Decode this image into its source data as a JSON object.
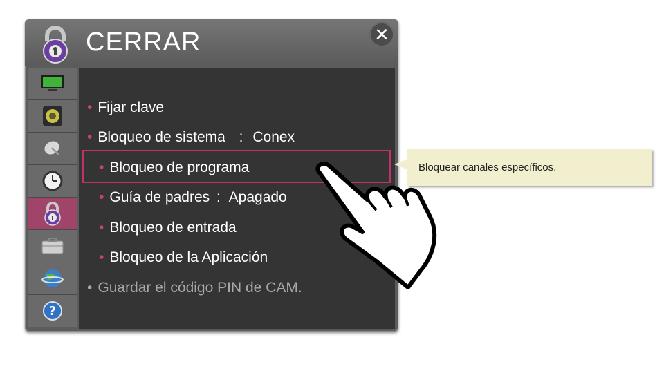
{
  "header": {
    "title": "CERRAR",
    "close_label": "✕"
  },
  "sidebar": {
    "items": [
      {
        "icon": "tv-icon"
      },
      {
        "icon": "speaker-icon"
      },
      {
        "icon": "satellite-icon"
      },
      {
        "icon": "clock-icon"
      },
      {
        "icon": "lock-icon",
        "active": true
      },
      {
        "icon": "toolbox-icon"
      },
      {
        "icon": "network-globe-icon"
      },
      {
        "icon": "help-icon"
      }
    ]
  },
  "menu": {
    "fijar_clave": "Fijar clave",
    "bloqueo_sistema": "Bloqueo de sistema",
    "bloqueo_sistema_sep": ":",
    "bloqueo_sistema_value": "Conex",
    "bloqueo_programa": "Bloqueo de programa",
    "guia_padres": "Guía de padres",
    "guia_padres_sep": ":",
    "guia_padres_value": "Apagado",
    "bloqueo_entrada": "Bloqueo de entrada",
    "bloqueo_aplicacion": "Bloqueo de la Aplicación",
    "guardar_pin": "Guardar el código PIN de CAM."
  },
  "tooltip": {
    "text": "Bloquear canales específicos."
  },
  "colors": {
    "accent": "#c9436f",
    "highlight_border": "#c0336a",
    "active_sidebar": "#a0446a"
  }
}
